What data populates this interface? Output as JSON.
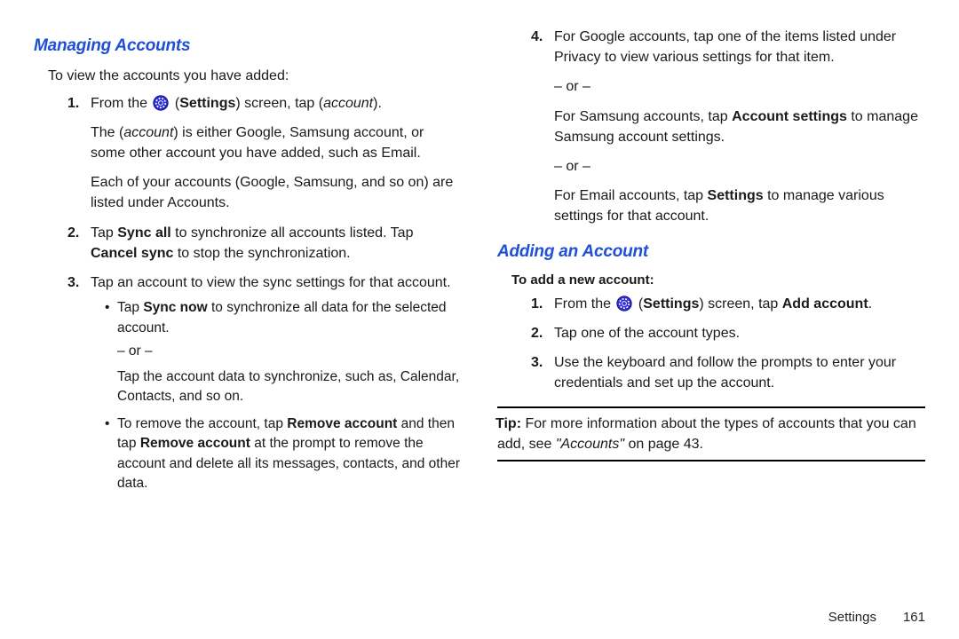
{
  "left": {
    "heading": "Managing Accounts",
    "intro": "To view the accounts you have added:",
    "steps": [
      {
        "num": "1.",
        "parts": [
          {
            "t": "From the "
          },
          {
            "icon": true
          },
          {
            "t": " (",
            "b": false
          },
          {
            "t": "Settings",
            "b": true
          },
          {
            "t": ") screen, tap ("
          },
          {
            "t": "account",
            "i": true
          },
          {
            "t": ")."
          }
        ],
        "paras": [
          [
            {
              "t": "The ("
            },
            {
              "t": "account",
              "i": true
            },
            {
              "t": ") is either Google, Samsung account, or some other account you have added, such as Email."
            }
          ],
          [
            {
              "t": "Each of your accounts (Google, Samsung, and so on) are listed under Accounts."
            }
          ]
        ]
      },
      {
        "num": "2.",
        "parts": [
          {
            "t": "Tap "
          },
          {
            "t": "Sync all",
            "b": true
          },
          {
            "t": " to synchronize all accounts listed. Tap "
          },
          {
            "t": "Cancel sync",
            "b": true
          },
          {
            "t": " to stop the synchronization."
          }
        ]
      },
      {
        "num": "3.",
        "parts": [
          {
            "t": "Tap an account to view the sync settings for that account."
          }
        ],
        "bullets": [
          {
            "main": [
              {
                "t": "Tap "
              },
              {
                "t": "Sync now",
                "b": true
              },
              {
                "t": " to synchronize all data for the selected account."
              }
            ],
            "or": "– or –",
            "sub": "Tap the account data to synchronize, such as, Calendar, Contacts, and so on."
          },
          {
            "main": [
              {
                "t": "To remove the account, tap "
              },
              {
                "t": "Remove account",
                "b": true
              },
              {
                "t": " and then tap "
              },
              {
                "t": "Remove account",
                "b": true
              },
              {
                "t": " at the prompt to remove the account and delete all its messages, contacts, and other data."
              }
            ]
          }
        ]
      }
    ]
  },
  "right": {
    "cont_step": {
      "num": "4.",
      "parts": [
        {
          "t": "For Google accounts, tap one of the items listed under Privacy to view various settings for that item."
        }
      ],
      "paras": [
        [
          {
            "t": "– or –"
          }
        ],
        [
          {
            "t": "For Samsung accounts, tap "
          },
          {
            "t": "Account settings",
            "b": true
          },
          {
            "t": " to manage Samsung account settings."
          }
        ],
        [
          {
            "t": "– or –"
          }
        ],
        [
          {
            "t": "For Email accounts, tap "
          },
          {
            "t": "Settings",
            "b": true
          },
          {
            "t": " to manage various settings for that account."
          }
        ]
      ]
    },
    "heading2": "Adding an Account",
    "sublabel": "To add a new account:",
    "steps2": [
      {
        "num": "1.",
        "parts": [
          {
            "t": "From the "
          },
          {
            "icon": true
          },
          {
            "t": " ("
          },
          {
            "t": "Settings",
            "b": true
          },
          {
            "t": ") screen, tap "
          },
          {
            "t": "Add account",
            "b": true
          },
          {
            "t": "."
          }
        ]
      },
      {
        "num": "2.",
        "parts": [
          {
            "t": "Tap one of the account types."
          }
        ]
      },
      {
        "num": "3.",
        "parts": [
          {
            "t": "Use the keyboard and follow the prompts to enter your credentials and set up the account."
          }
        ]
      }
    ],
    "tip": {
      "label": "Tip:",
      "text_pre": " For more information about the types of accounts that you can add, see ",
      "ref": "\"Accounts\"",
      "text_post": " on page 43."
    }
  },
  "footer": {
    "section": "Settings",
    "page": "161"
  }
}
